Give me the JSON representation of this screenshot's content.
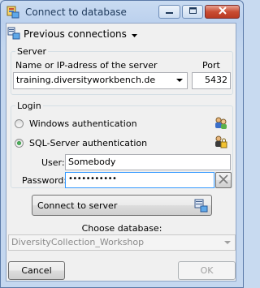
{
  "window": {
    "title": "Connect to database"
  },
  "toolbar": {
    "previous_connections_label": "Previous connections"
  },
  "server": {
    "group_title": "Server",
    "name_label": "Name or IP-adress of the server",
    "port_label": "Port",
    "name_value": "training.diversityworkbench.de",
    "port_value": "5432"
  },
  "login": {
    "group_title": "Login",
    "windows_auth_label": "Windows authentication",
    "sql_auth_label": "SQL-Server authentication",
    "selected_auth": "sql",
    "user_label": "User:",
    "user_value": "Somebody",
    "password_label": "Password:",
    "password_masked": "•••••••••••"
  },
  "connect": {
    "button_label": "Connect to server"
  },
  "database": {
    "label": "Choose database:",
    "selected_value": "DiversityCollection_Workshop"
  },
  "footer": {
    "cancel_label": "Cancel",
    "ok_label": "OK"
  },
  "icons": {
    "app": "database-connect-icon",
    "previous_connections": "connections-list-icon",
    "windows_auth": "windows-users-icon",
    "sql_auth": "sql-user-lock-icon",
    "connect": "server-connect-icon",
    "clear_password": "clear-x-icon"
  },
  "colors": {
    "accent": "#3399ff",
    "title_text": "#1e395b",
    "close_button": "#c94c33"
  }
}
